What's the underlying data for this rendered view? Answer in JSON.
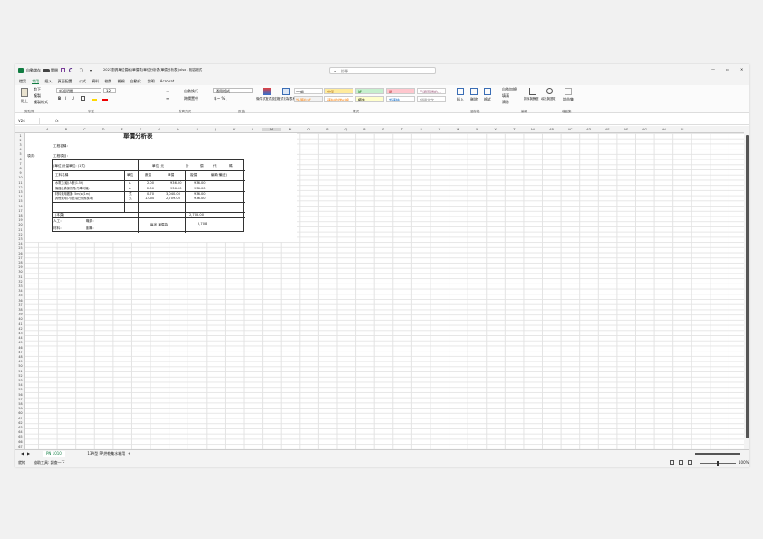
{
  "titlebar": {
    "autosave": "自動儲存",
    "autosave_state": "關閉",
    "file": "2023廚具單位價格(單價表)單位分析表(單價分析表).xlsx - 相容模式",
    "search_placeholder": "搜尋",
    "share": "共用"
  },
  "menu": [
    "檔案",
    "常用",
    "插入",
    "頁面配置",
    "公式",
    "資料",
    "校閱",
    "檢視",
    "自動化",
    "說明",
    "Acrobat"
  ],
  "menu_active": 1,
  "ribbon": {
    "paste": "貼上",
    "cut": "剪下",
    "copy": "複製",
    "format_painter": "複製格式",
    "font": "新細明體",
    "size": "12",
    "wrap": "自動換行",
    "merge": "跨欄置中",
    "numfmt": "通用格式",
    "cond": "條件式格式設定",
    "table": "格式化為表格",
    "styles": [
      {
        "label": "一般",
        "bg": "#ffffff",
        "fg": "#000000"
      },
      {
        "label": "中等",
        "bg": "#ffeb9c",
        "fg": "#9c5700"
      },
      {
        "label": "好",
        "bg": "#c6efce",
        "fg": "#006100"
      },
      {
        "label": "壞",
        "bg": "#ffc7ce",
        "fg": "#9c0006"
      },
      {
        "label": "已瀏覽過的...",
        "bg": "#ffffff",
        "fg": "#954f72"
      },
      {
        "label": "計算方式",
        "bg": "#f2f2f2",
        "fg": "#fa7d00"
      },
      {
        "label": "連結的儲存格",
        "bg": "#ffffff",
        "fg": "#fa7d00"
      },
      {
        "label": "備註",
        "bg": "#ffffcc",
        "fg": "#000000"
      },
      {
        "label": "超連結",
        "bg": "#ffffff",
        "fg": "#0563c1"
      },
      {
        "label": "說明文字",
        "bg": "#ffffff",
        "fg": "#7f7f7f"
      }
    ],
    "insert": "插入",
    "delete": "刪除",
    "format": "格式",
    "autosum": "自動加總",
    "fill": "填滿",
    "clear": "清除",
    "sort": "排序與篩選",
    "find": "尋找與選取",
    "addin": "增益集",
    "groups": [
      "剪貼簿",
      "字型",
      "對齊方式",
      "數值",
      "樣式",
      "儲存格",
      "編輯",
      "增益集"
    ]
  },
  "formula": {
    "namebox": "V24",
    "fx": "fx",
    "content": ""
  },
  "columns": [
    "A",
    "B",
    "C",
    "D",
    "E",
    "F",
    "G",
    "H",
    "I",
    "J",
    "K",
    "L",
    "M",
    "N",
    "O",
    "P",
    "Q",
    "R",
    "S",
    "T",
    "U",
    "V",
    "W",
    "X",
    "Y",
    "Z",
    "AA",
    "AB",
    "AC",
    "AD",
    "AE",
    "AF",
    "AG",
    "AH",
    "AI"
  ],
  "active_column": "M",
  "rows": [
    "1",
    "2",
    "3",
    "4",
    "5",
    "6",
    "7",
    "8",
    "9",
    "10",
    "11",
    "12",
    "13",
    "14",
    "15",
    "16",
    "17",
    "18",
    "19",
    "20",
    "21",
    "22",
    "23",
    "24",
    "25",
    "26",
    "27",
    "28",
    "29",
    "30",
    "31",
    "32",
    "33",
    "34",
    "35",
    "36",
    "37",
    "38",
    "39",
    "40",
    "41",
    "42",
    "43",
    "44",
    "45",
    "46",
    "47",
    "48",
    "49",
    "50",
    "51",
    "52",
    "53",
    "54",
    "55",
    "56",
    "57",
    "58",
    "59",
    "60",
    "61",
    "62",
    "63",
    "64",
    "65",
    "66",
    "67"
  ],
  "sheet": {
    "title": "單價分析表",
    "a3": "工程名稱：",
    "a4_left": "項次：",
    "a4": "工程項目：",
    "r5_label": "(單位)計量單位: (1式)",
    "r5_price": "單位: 元",
    "r5_b": "計",
    "r5_c": "價",
    "r5_d": "代",
    "r5_e": "碼",
    "headers": [
      "工料名稱",
      "單位",
      "數量",
      "單價",
      "複價",
      "編碼(備註)"
    ],
    "items": [
      {
        "name": "水電工(級)人數(1.5h)",
        "unit": "A",
        "qty": "2.00",
        "price": "936.00",
        "total": "936.00"
      },
      {
        "name": "機器設備操作員(吊車司機)",
        "unit": "A",
        "qty": "2.00",
        "price": "936.00",
        "total": "936.00"
      },
      {
        "name": "材料費用搬運: 5m(s)(1m)",
        "unit": "式",
        "qty": "0.70",
        "price": "3,040.00",
        "total": "936.00"
      },
      {
        "name": "其他費用(7)(此項已依照核本)",
        "unit": "式",
        "qty": "1.000",
        "price": "2,709.00",
        "total": "936.00"
      }
    ],
    "subtotal_label": "(本頁)",
    "subtotal": "2,708.00",
    "labor_label": "人工：",
    "labor_name": "職員：",
    "material_label": "材料：",
    "material_name": "副職：",
    "sign_label": "每米 單價為",
    "sign_value": "2,708"
  },
  "tabs": [
    "PN 1010",
    "13A型 FP烘乾集水箱用"
  ],
  "active_tab": 0,
  "status": {
    "ready": "就緒",
    "accessibility": "協助工具: 調查一下",
    "zoom": "100%"
  }
}
